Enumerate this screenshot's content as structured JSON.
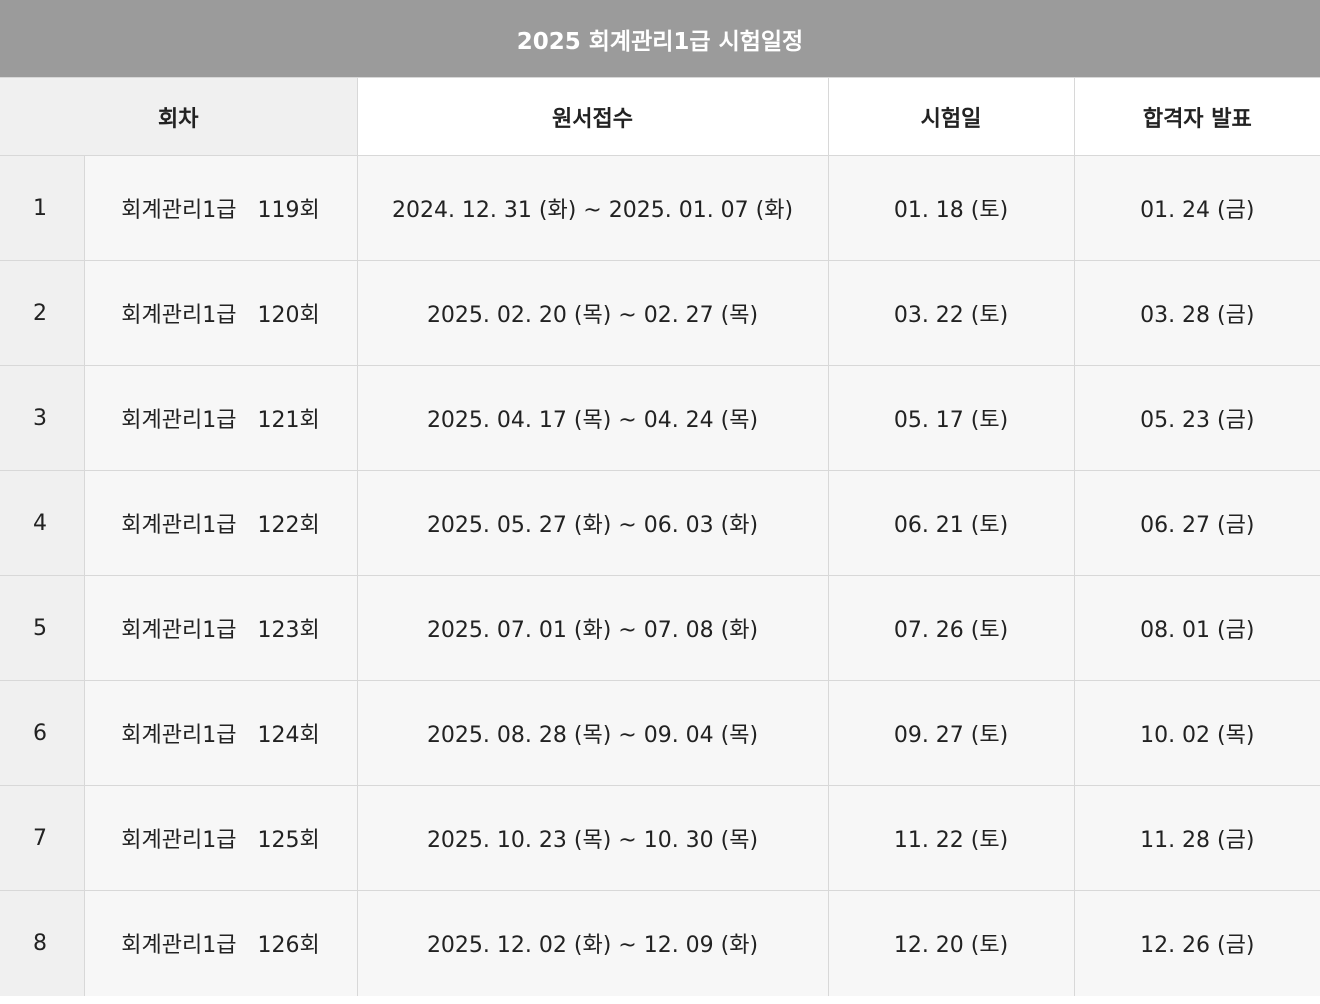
{
  "title": "2025 회계관리1급 시험일정",
  "headers": {
    "round": "회차",
    "apply": "원서접수",
    "exam": "시험일",
    "result": "합격자 발표"
  },
  "rows": [
    {
      "no": "1",
      "name": "회계관리1급   119회",
      "apply": "2024. 12. 31 (화) ~ 2025. 01. 07 (화)",
      "exam": "01. 18 (토)",
      "result": "01. 24 (금)"
    },
    {
      "no": "2",
      "name": "회계관리1급   120회",
      "apply": "2025. 02. 20 (목) ~ 02. 27 (목)",
      "exam": "03. 22 (토)",
      "result": "03. 28 (금)"
    },
    {
      "no": "3",
      "name": "회계관리1급   121회",
      "apply": "2025. 04. 17 (목) ~ 04. 24 (목)",
      "exam": "05. 17 (토)",
      "result": "05. 23 (금)"
    },
    {
      "no": "4",
      "name": "회계관리1급   122회",
      "apply": "2025. 05. 27 (화) ~ 06. 03 (화)",
      "exam": "06. 21 (토)",
      "result": "06. 27 (금)"
    },
    {
      "no": "5",
      "name": "회계관리1급   123회",
      "apply": "2025. 07. 01 (화) ~ 07. 08 (화)",
      "exam": "07. 26 (토)",
      "result": "08. 01 (금)"
    },
    {
      "no": "6",
      "name": "회계관리1급   124회",
      "apply": "2025. 08. 28 (목) ~ 09. 04 (목)",
      "exam": "09. 27 (토)",
      "result": "10. 02 (목)"
    },
    {
      "no": "7",
      "name": "회계관리1급   125회",
      "apply": "2025. 10. 23 (목) ~ 10. 30 (목)",
      "exam": "11. 22 (토)",
      "result": "11. 28 (금)"
    },
    {
      "no": "8",
      "name": "회계관리1급   126회",
      "apply": "2025. 12. 02 (화) ~ 12. 09 (화)",
      "exam": "12. 20 (토)",
      "result": "12. 26 (금)"
    }
  ]
}
